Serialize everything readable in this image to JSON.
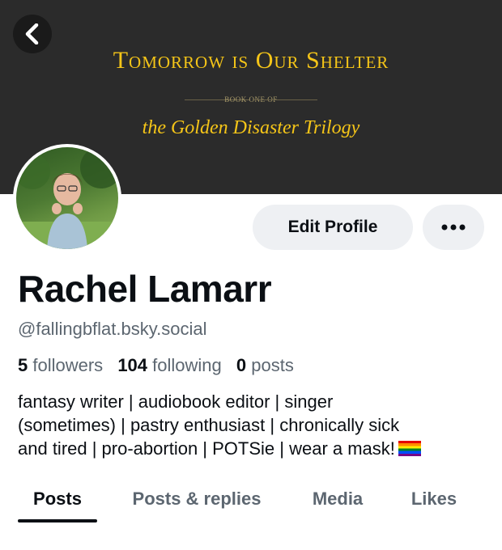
{
  "banner": {
    "title": "Tomorrow is Our Shelter",
    "subtitle": "BOOK ONE OF",
    "script_line": "the Golden Disaster Trilogy",
    "bg_color": "#2b2b2b",
    "text_color": "#f5c518"
  },
  "nav": {
    "back_icon": "chevron-left-icon"
  },
  "actions": {
    "edit_label": "Edit Profile",
    "more_icon": "ellipsis-icon"
  },
  "profile": {
    "name": "Rachel Lamarr",
    "handle": "@fallingbflat.bsky.social",
    "followers_count": "5",
    "followers_label": "followers",
    "following_count": "104",
    "following_label": "following",
    "posts_count": "0",
    "posts_label": "posts",
    "bio_line1": "fantasy writer | audiobook editor | singer",
    "bio_line2": "(sometimes) | pastry enthusiast | chronically sick",
    "bio_line3": "and tired | pro-abortion | POTSie | wear a mask!",
    "bio_emoji": "rainbow-flag-icon"
  },
  "tabs": [
    {
      "label": "Posts",
      "active": true
    },
    {
      "label": "Posts & replies",
      "active": false
    },
    {
      "label": "Media",
      "active": false
    },
    {
      "label": "Likes",
      "active": false
    }
  ]
}
